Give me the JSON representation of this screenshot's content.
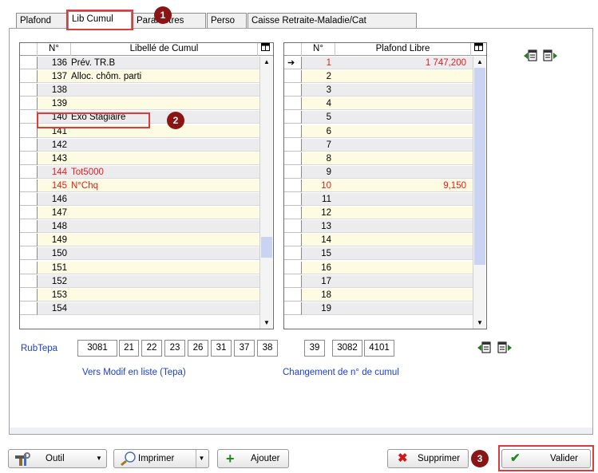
{
  "tabs": [
    {
      "label": "Plafond"
    },
    {
      "label": "Lib Cumul"
    },
    {
      "label": "Paramètres"
    },
    {
      "label": "Perso"
    },
    {
      "label": "Caisse Retraite-Maladie/Cat"
    }
  ],
  "left_grid": {
    "headers": {
      "num": "N°",
      "label": "Libellé de Cumul"
    },
    "rows": [
      {
        "num": "136",
        "label": "Prév. TR.B",
        "red": false
      },
      {
        "num": "137",
        "label": "Alloc. chôm. parti",
        "red": false
      },
      {
        "num": "138",
        "label": "",
        "red": false
      },
      {
        "num": "139",
        "label": "",
        "red": false
      },
      {
        "num": "140",
        "label": "Exo Stagiaire",
        "red": false
      },
      {
        "num": "141",
        "label": "",
        "red": false
      },
      {
        "num": "142",
        "label": "",
        "red": false
      },
      {
        "num": "143",
        "label": "",
        "red": false
      },
      {
        "num": "144",
        "label": "Tot5000",
        "red": true
      },
      {
        "num": "145",
        "label": "N°Chq",
        "red": true
      },
      {
        "num": "146",
        "label": "",
        "red": false
      },
      {
        "num": "147",
        "label": "",
        "red": false
      },
      {
        "num": "148",
        "label": "",
        "red": false
      },
      {
        "num": "149",
        "label": "",
        "red": false
      },
      {
        "num": "150",
        "label": "",
        "red": false
      },
      {
        "num": "151",
        "label": "",
        "red": false
      },
      {
        "num": "152",
        "label": "",
        "red": false
      },
      {
        "num": "153",
        "label": "",
        "red": false
      },
      {
        "num": "154",
        "label": "",
        "red": false
      }
    ]
  },
  "right_grid": {
    "headers": {
      "num": "N°",
      "value": "Plafond Libre"
    },
    "rows": [
      {
        "num": "1",
        "value": "1 747,200",
        "red": true
      },
      {
        "num": "2",
        "value": "",
        "red": false
      },
      {
        "num": "3",
        "value": "",
        "red": false
      },
      {
        "num": "4",
        "value": "",
        "red": false
      },
      {
        "num": "5",
        "value": "",
        "red": false
      },
      {
        "num": "6",
        "value": "",
        "red": false
      },
      {
        "num": "7",
        "value": "",
        "red": false
      },
      {
        "num": "8",
        "value": "",
        "red": false
      },
      {
        "num": "9",
        "value": "",
        "red": false
      },
      {
        "num": "10",
        "value": "9,150",
        "red": true
      },
      {
        "num": "11",
        "value": "",
        "red": false
      },
      {
        "num": "12",
        "value": "",
        "red": false
      },
      {
        "num": "13",
        "value": "",
        "red": false
      },
      {
        "num": "14",
        "value": "",
        "red": false
      },
      {
        "num": "15",
        "value": "",
        "red": false
      },
      {
        "num": "16",
        "value": "",
        "red": false
      },
      {
        "num": "17",
        "value": "",
        "red": false
      },
      {
        "num": "18",
        "value": "",
        "red": false
      },
      {
        "num": "19",
        "value": "",
        "red": false
      }
    ]
  },
  "rubtepa": {
    "label": "RubTepa",
    "values": [
      "3081",
      "21",
      "22",
      "23",
      "26",
      "31",
      "37",
      "38",
      "39",
      "3082",
      "4101"
    ]
  },
  "links": {
    "vers_modif": "Vers Modif en liste (Tepa)",
    "changement": "Changement de n° de cumul"
  },
  "toolbar": {
    "outil": "Outil",
    "imprimer": "Imprimer",
    "ajouter": "Ajouter",
    "supprimer": "Supprimer",
    "valider": "Valider"
  },
  "badges": [
    "1",
    "2",
    "3"
  ],
  "colors": {
    "link": "#1c3fd1",
    "red_text": "#e02020",
    "badge": "#8b1414",
    "highlight": "#e03b3b"
  }
}
